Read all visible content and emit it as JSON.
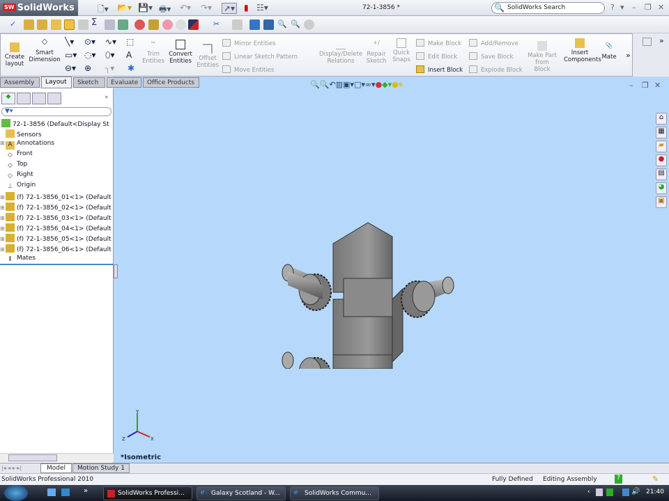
{
  "app": {
    "logo": "SolidWorks",
    "logo_badge": "SW",
    "document_title": "72-1-3856 *",
    "search_placeholder": "SolidWorks Search",
    "help": "?"
  },
  "ribbon": {
    "create_layout": "Create layout",
    "smart_dimension": "Smart Dimension",
    "trim_entities": "Trim Entities",
    "convert_entities": "Convert Entities",
    "offset_entities": "Offset Entities",
    "mirror_entities": "Mirror Entities",
    "linear_sketch_pattern": "Linear Sketch Pattern",
    "move_entities": "Move Entities",
    "display_delete_relations": "Display/Delete Relations",
    "repair_sketch": "Repair Sketch",
    "quick_snaps": "Quick Snaps",
    "make_block": "Make Block",
    "edit_block": "Edit Block",
    "insert_block": "Insert Block",
    "add_remove": "Add/Remove",
    "save_block": "Save Block",
    "explode_block": "Explode Block",
    "make_part_from_block": "Make Part from Block",
    "insert_components": "Insert Components",
    "mate": "Mate"
  },
  "tabs": [
    {
      "label": "Assembly"
    },
    {
      "label": "Layout",
      "active": true
    },
    {
      "label": "Sketch"
    },
    {
      "label": "Evaluate"
    },
    {
      "label": "Office Products"
    }
  ],
  "feature_tree": {
    "root": "72-1-3856  (Default<Display Stat",
    "items": [
      {
        "label": "Sensors",
        "icon": "sensor-folder-icon"
      },
      {
        "label": "Annotations",
        "icon": "annotations-icon"
      },
      {
        "label": "Front",
        "icon": "plane-icon"
      },
      {
        "label": "Top",
        "icon": "plane-icon"
      },
      {
        "label": "Right",
        "icon": "plane-icon"
      },
      {
        "label": "Origin",
        "icon": "origin-icon"
      },
      {
        "label": "(f) 72-1-3856_01<1> (Default",
        "icon": "part-icon"
      },
      {
        "label": "(f) 72-1-3856_02<1> (Default",
        "icon": "part-icon"
      },
      {
        "label": "(f) 72-1-3856_03<1> (Default",
        "icon": "part-icon"
      },
      {
        "label": "(f) 72-1-3856_04<1> (Default",
        "icon": "part-icon"
      },
      {
        "label": "(f) 72-1-3856_05<1> (Default",
        "icon": "part-icon"
      },
      {
        "label": "(f) 72-1-3856_06<1> (Default",
        "icon": "part-icon"
      },
      {
        "label": "Mates",
        "icon": "mates-icon"
      }
    ]
  },
  "viewport": {
    "view_name": "*Isometric",
    "triad": {
      "x": "X",
      "y": "Y",
      "z": "Z"
    },
    "background": "#b6d8fa"
  },
  "bottom_tabs": [
    {
      "label": "Model"
    },
    {
      "label": "Motion Study 1"
    }
  ],
  "status": {
    "product": "SolidWorks Professional 2010",
    "state": "Fully Defined",
    "mode": "Editing Assembly"
  },
  "taskbar": {
    "tasks": [
      {
        "label": "SolidWorks Professi..."
      },
      {
        "label": "Galaxy Scotland - W..."
      },
      {
        "label": "SolidWorks Commu..."
      }
    ],
    "clock": "21:40"
  }
}
